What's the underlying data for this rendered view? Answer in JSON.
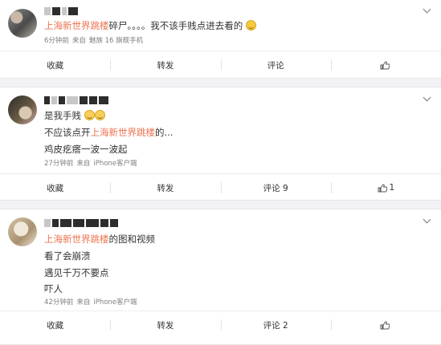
{
  "keyword": "上海新世界跳楼",
  "posts": [
    {
      "lines": [
        {
          "before": "",
          "keyword": "上海新世界跳楼",
          "after": "碎尸。。。。我不该手贱点进去看的",
          "emoji": "sad"
        }
      ],
      "meta": {
        "time": "6分钟前",
        "source_prefix": "来自",
        "source": "魅族 16 旗舰手机"
      },
      "actions": {
        "favorite": "收藏",
        "repost": "转发",
        "comment": "评论",
        "like_count": ""
      }
    },
    {
      "lines": [
        {
          "before": "是我手贱",
          "keyword": "",
          "after": "",
          "emoji": "shy"
        },
        {
          "before": "不应该点开",
          "keyword": "上海新世界跳楼",
          "after": "的...",
          "emoji": ""
        },
        {
          "before": "鸡皮疙瘩一波一波起",
          "keyword": "",
          "after": "",
          "emoji": ""
        }
      ],
      "meta": {
        "time": "27分钟前",
        "source_prefix": "来自",
        "source": "iPhone客户端"
      },
      "actions": {
        "favorite": "收藏",
        "repost": "转发",
        "comment": "评论 9",
        "like_count": "1"
      }
    },
    {
      "lines": [
        {
          "before": "",
          "keyword": "上海新世界跳楼",
          "after": "的图和视频",
          "emoji": ""
        },
        {
          "before": "看了会崩溃",
          "keyword": "",
          "after": "",
          "emoji": ""
        },
        {
          "before": "遇见千万不要点",
          "keyword": "",
          "after": "",
          "emoji": ""
        },
        {
          "before": "吓人",
          "keyword": "",
          "after": "",
          "emoji": ""
        }
      ],
      "meta": {
        "time": "42分钟前",
        "source_prefix": "来自",
        "source": "iPhone客户端"
      },
      "actions": {
        "favorite": "收藏",
        "repost": "转发",
        "comment": "评论 2",
        "like_count": ""
      }
    }
  ],
  "colors": {
    "keyword": "#eb7350",
    "text": "#333333",
    "meta": "#808080",
    "background": "#f2f2f5"
  },
  "icons": {
    "menu": "chevron-down-icon",
    "like": "thumbs-up-icon",
    "emoji_sad": "crying-emoji-icon",
    "emoji_shy": "shy-emoji-icon"
  }
}
